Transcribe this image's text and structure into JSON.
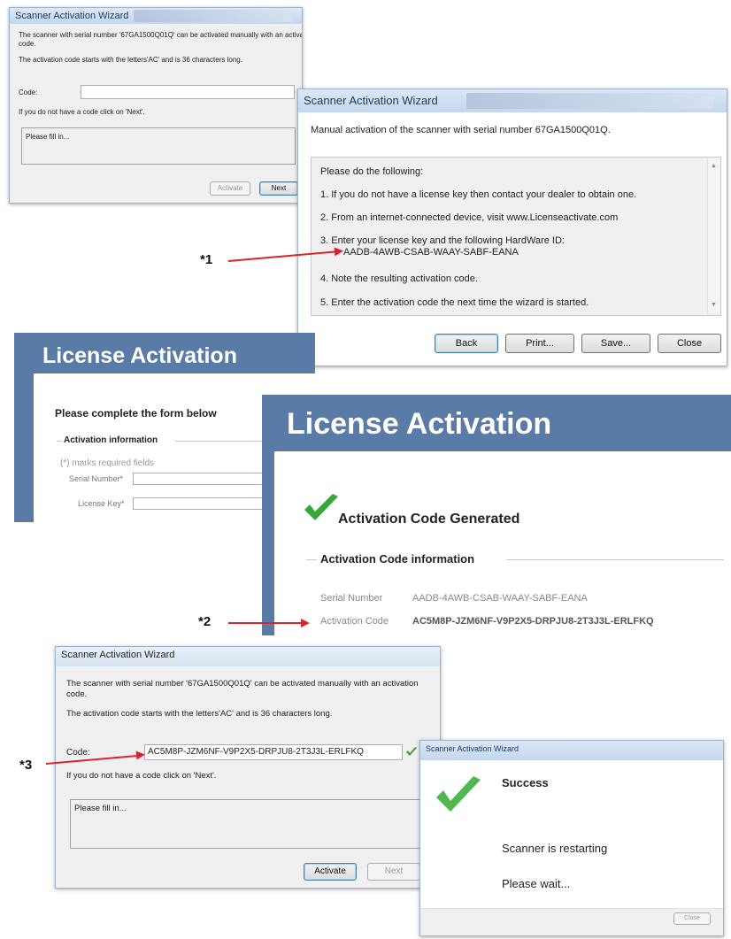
{
  "wizard_top": {
    "title": "Scanner Activation Wizard",
    "line1": "The scanner with serial number '67GA1500Q01Q' can be activated manually with an activation",
    "line1b": "code.",
    "line2": "The activation code starts with the letters'AC' and is 36 characters long.",
    "code_label": "Code:",
    "code_value": "",
    "hint": "If you do not have a code click on 'Next'.",
    "status": "Please fill in...",
    "activate_label": "Activate",
    "next_label": "Next"
  },
  "manual_dialog": {
    "title": "Scanner Activation Wizard",
    "header": "Manual activation of the scanner with serial number 67GA1500Q01Q.",
    "intro": "Please do the following:",
    "steps": [
      "1. If you do not have a license key then contact your dealer to obtain one.",
      "2. From an internet-connected device, visit www.Licenseactivate.com",
      "3. Enter your license key and the following HardWare ID:",
      "4. Note the resulting activation code.",
      "5. Enter the activation code the next time the wizard is started."
    ],
    "hardware_id": "AADB-4AWB-CSAB-WAAY-SABF-EANA",
    "back_label": "Back",
    "print_label": "Print...",
    "save_label": "Save...",
    "close_label": "Close"
  },
  "license_form": {
    "banner": "License Activation",
    "heading": "Please complete the form below",
    "section": "Activation information",
    "required_note": "(*) marks required fields",
    "serial_label": "Serial Number*",
    "license_label": "License Key*"
  },
  "license_result": {
    "banner": "License Activation",
    "generated": "Activation Code Generated",
    "section": "Activation Code information",
    "serial_label": "Serial Number",
    "serial_value": "AADB-4AWB-CSAB-WAAY-SABF-EANA",
    "code_label": "Activation Code",
    "code_value": "AC5M8P-JZM6NF-V9P2X5-DRPJU8-2T3J3L-ERLFKQ"
  },
  "wizard_bottom": {
    "title": "Scanner Activation Wizard",
    "line1": "The scanner with serial number '67GA1500Q01Q' can be activated manually with an activation",
    "line1b": "code.",
    "line2": "The activation code starts with the letters'AC' and is 36 characters long.",
    "code_label": "Code:",
    "code_value": "AC5M8P-JZM6NF-V9P2X5-DRPJU8-2T3J3L-ERLFKQ",
    "hint": "If you do not have a code click on 'Next'.",
    "status": "Please fill in...",
    "activate_label": "Activate",
    "next_label": "Next"
  },
  "success_dialog": {
    "title": "Scanner Activation Wizard",
    "heading": "Success",
    "line1": "Scanner is restarting",
    "line2": "Please wait...",
    "close_label": "Close"
  },
  "markers": {
    "m1": "*1",
    "m2": "*2",
    "m3": "*3"
  },
  "colors": {
    "arrow": "#d6262b",
    "banner": "#5a7ba6",
    "check": "#3aa63a"
  }
}
